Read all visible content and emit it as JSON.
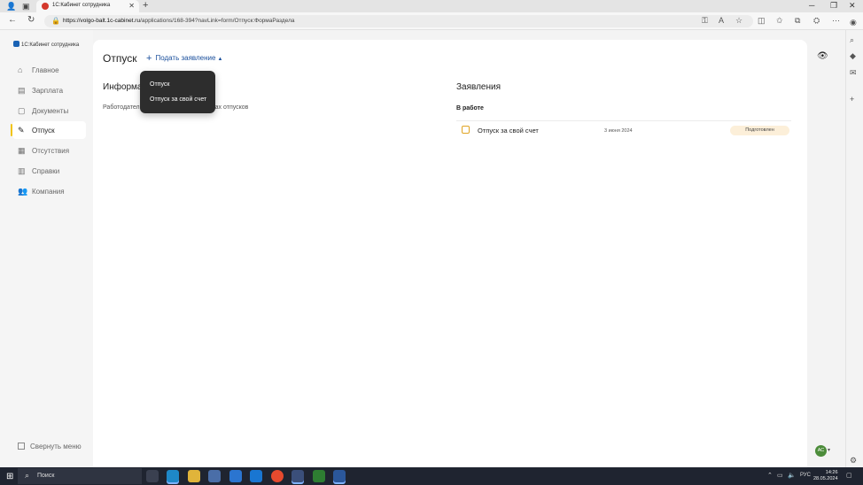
{
  "browser": {
    "tab_title": "1С:Кабинет сотрудника",
    "url_host": "https://volgo-balt.1c-cabinet.ru",
    "url_path": "/applications/168-394?navLink=form/Отпуск:ФормаРаздела"
  },
  "app": {
    "logo_text": "1С:Кабинет сотрудника",
    "nav": [
      {
        "label": "Главное",
        "icon": "home-icon"
      },
      {
        "label": "Зарплата",
        "icon": "wallet-icon"
      },
      {
        "label": "Документы",
        "icon": "document-icon"
      },
      {
        "label": "Отпуск",
        "icon": "vacation-icon",
        "active": true
      },
      {
        "label": "Отсутствия",
        "icon": "absence-icon"
      },
      {
        "label": "Справки",
        "icon": "certificate-icon"
      },
      {
        "label": "Компания",
        "icon": "company-icon"
      }
    ],
    "collapse_label": "Свернуть меню"
  },
  "page": {
    "title": "Отпуск",
    "submit_label": "Подать заявление",
    "dropdown": [
      "Отпуск",
      "Отпуск за свой счет"
    ],
    "info_title": "Информа",
    "info_text_start": "Работодател",
    "info_text_end": "ах отпусков",
    "apps_title": "Заявления",
    "in_work_label": "В работе",
    "applications": [
      {
        "name": "Отпуск за свой счет",
        "date": "3 июня 2024",
        "status": "Подготовлен"
      }
    ]
  },
  "user": {
    "initials": "АС"
  },
  "taskbar": {
    "search_label": "Поиск",
    "lang": "РУС",
    "time": "14:26",
    "date": "28.05.2024"
  },
  "colors": {
    "accent": "#1a4f9c",
    "active_marker": "#f1c40f",
    "status_badge_bg": "#fcefd9"
  }
}
